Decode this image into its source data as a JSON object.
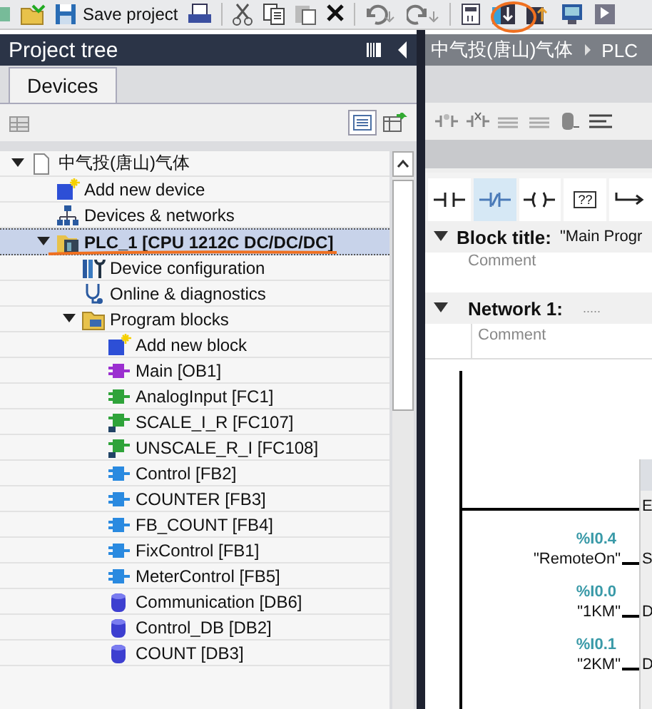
{
  "toolbar": {
    "items": [
      {
        "kind": "partial"
      },
      {
        "kind": "open"
      },
      {
        "kind": "save",
        "label": "Save project"
      },
      {
        "kind": "print"
      },
      {
        "kind": "sep"
      },
      {
        "kind": "cut"
      },
      {
        "kind": "copy"
      },
      {
        "kind": "paste"
      },
      {
        "kind": "delete"
      },
      {
        "kind": "sep"
      },
      {
        "kind": "undo"
      },
      {
        "kind": "redo"
      },
      {
        "kind": "sep"
      },
      {
        "kind": "compile"
      },
      {
        "kind": "download"
      },
      {
        "kind": "upload"
      },
      {
        "kind": "online"
      },
      {
        "kind": "simulate"
      }
    ]
  },
  "project_tree": {
    "title": "Project tree",
    "tabs": [
      {
        "label": "Devices",
        "selected": true
      }
    ],
    "items": [
      {
        "label": "中气投(唐山)气体",
        "kind": "project",
        "expanded": true,
        "selected": false,
        "children": [
          {
            "label": "Add new device",
            "kind": "add-device",
            "selected": false
          },
          {
            "label": "Devices & networks",
            "kind": "network",
            "selected": false
          },
          {
            "label": "PLC_1 [CPU 1212C DC/DC/DC]",
            "kind": "plc",
            "expanded": true,
            "selected": true,
            "children": [
              {
                "label": "Device configuration",
                "kind": "device-config",
                "selected": false
              },
              {
                "label": "Online & diagnostics",
                "kind": "online",
                "selected": false
              },
              {
                "label": "Program blocks",
                "kind": "folder",
                "expanded": true,
                "selected": false,
                "children": [
                  {
                    "label": "Add new block",
                    "kind": "add-block",
                    "selected": false
                  },
                  {
                    "label": "Main [OB1]",
                    "kind": "ob",
                    "selected": false
                  },
                  {
                    "label": "AnalogInput [FC1]",
                    "kind": "fc",
                    "selected": false
                  },
                  {
                    "label": "SCALE_I_R [FC107]",
                    "kind": "fc-locked",
                    "selected": false
                  },
                  {
                    "label": "UNSCALE_R_I [FC108]",
                    "kind": "fc-locked",
                    "selected": false
                  },
                  {
                    "label": "Control [FB2]",
                    "kind": "fb",
                    "selected": false
                  },
                  {
                    "label": "COUNTER [FB3]",
                    "kind": "fb",
                    "selected": false
                  },
                  {
                    "label": "FB_COUNT [FB4]",
                    "kind": "fb",
                    "selected": false
                  },
                  {
                    "label": "FixControl [FB1]",
                    "kind": "fb",
                    "selected": false
                  },
                  {
                    "label": "MeterControl [FB5]",
                    "kind": "fb",
                    "selected": false
                  },
                  {
                    "label": "Communication [DB6]",
                    "kind": "db",
                    "selected": false
                  },
                  {
                    "label": "Control_DB [DB2]",
                    "kind": "db",
                    "selected": false
                  },
                  {
                    "label": "COUNT [DB3]",
                    "kind": "db",
                    "selected": false
                  }
                ]
              }
            ]
          }
        ]
      }
    ]
  },
  "editor": {
    "breadcrumb": [
      "中气投(唐山)气体",
      "PLC"
    ],
    "instructions": [
      {
        "kind": "no-contact",
        "selected": false
      },
      {
        "kind": "nc-contact",
        "selected": true
      },
      {
        "kind": "coil",
        "selected": false
      },
      {
        "kind": "box",
        "label": "??",
        "selected": false
      },
      {
        "kind": "branch",
        "selected": false
      }
    ],
    "block_title": {
      "label": "Block title:",
      "value": "\"Main Progr",
      "comment": "Comment"
    },
    "network": {
      "label": "Network 1:",
      "title": ".....",
      "comment": "Comment",
      "expanded": true,
      "pins": [
        {
          "pin": "E"
        },
        {
          "address": "%I0.4",
          "tag": "\"RemoteOn\"",
          "pin": "S"
        },
        {
          "address": "%I0.0",
          "tag": "\"1KM\"",
          "pin": "D"
        },
        {
          "address": "%I0.1",
          "tag": "\"2KM\"",
          "pin": "D"
        }
      ]
    }
  }
}
